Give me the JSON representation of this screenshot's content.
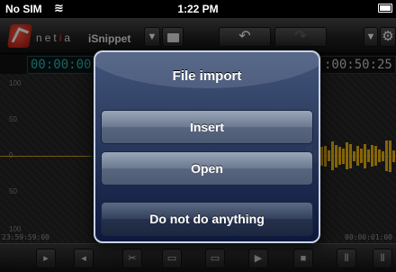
{
  "status_bar": {
    "carrier": "No SIM",
    "time": "1:22 PM"
  },
  "toolbar": {
    "brand": "netia",
    "app_title": "iSnippet",
    "dropdown_glyph": "▼",
    "undo_glyph": "↶",
    "redo_glyph": "↷",
    "settings_glyph": "⚙"
  },
  "timeline": {
    "start_timecode": "00:00:00",
    "end_timecode": ":00:50:25"
  },
  "waveform": {
    "level_labels": [
      "100",
      "50",
      "0",
      "50",
      "100"
    ],
    "start_time": "23:59:59:00",
    "end_time": "00:00:01:00",
    "colors": {
      "wave": "#f0b810",
      "timecode": "#2fb7b7"
    }
  },
  "transport": {
    "play_glyph": "▶"
  },
  "dialog": {
    "title": "File import",
    "buttons": {
      "insert": "Insert",
      "open": "Open",
      "do_nothing": "Do not do anything"
    }
  }
}
